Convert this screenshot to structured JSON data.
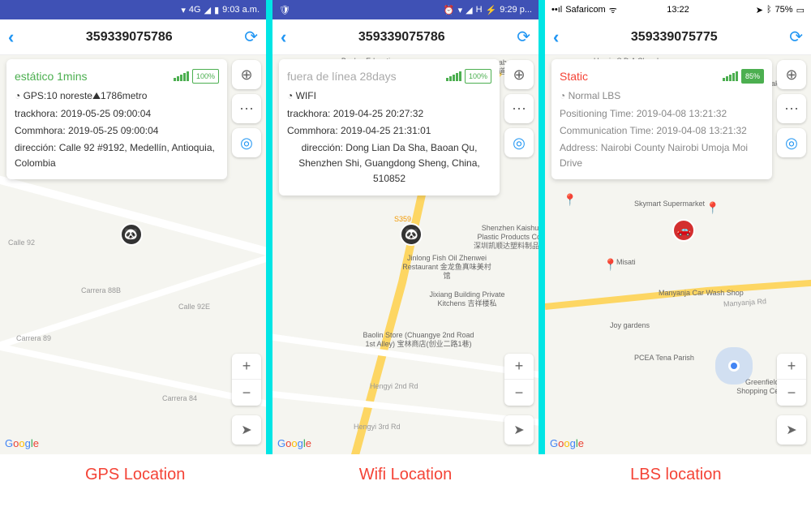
{
  "panels": [
    {
      "statusbar": {
        "type": "android",
        "network": "4G",
        "time": "9:03 a.m."
      },
      "header": {
        "title": "359339075786"
      },
      "info": {
        "status": "estático 1mins",
        "statusClass": "status-green",
        "battery": "100%",
        "line1": "GPS:10 noreste⛰1786metro",
        "line2": "trackhora: 2019-05-25 09:00:04",
        "line3": "Commhora: 2019-05-25 09:00:04",
        "addr": "dirección: Calle 92 #9192, Medellín, Antioquia, Colombia"
      },
      "marker": {
        "icon": "🐼",
        "class": ""
      },
      "label": "GPS Location"
    },
    {
      "statusbar": {
        "type": "android",
        "network": "H",
        "time": "9:29 p..."
      },
      "header": {
        "title": "359339075786"
      },
      "info": {
        "status": "fuera de línea 28days",
        "statusClass": "status-grey",
        "battery": "100%",
        "line1": "WIFI",
        "line2": "trackhora: 2019-04-25 20:27:32",
        "line3": "Commhora: 2019-04-25 21:31:01",
        "addr": "dirección: Dong Lian Da Sha, Baoan Qu, Shenzhen Shi, Guangdong Sheng, China, 510852"
      },
      "marker": {
        "icon": "🐼",
        "class": ""
      },
      "maplabels": [
        "Bao'an Education Industrial Zone 宝安教育工业区",
        "GAC Toyota Daxing Dabao Branch 广汽丰田大道",
        "Jinlong Fish Oil Zhenwei Restaurant 金龙鱼真味美村馆",
        "Jixiang Building Private Kitchens 吉祥楼私",
        "Baolin Store (Chuangye 2nd Road 1st Alley) 宝林商店(创业二路1巷)",
        "Shenzhen Kaishu Plastic Products Co. 深圳凯顺达塑料制品厂"
      ],
      "label": "Wifi Location"
    },
    {
      "statusbar": {
        "type": "ios",
        "carrier": "Safaricom",
        "time": "13:22",
        "battery": "75%"
      },
      "header": {
        "title": "359339075775"
      },
      "info": {
        "status": "Static",
        "statusClass": "status-red",
        "battery": "85%",
        "line1": "Normal  LBS",
        "line2": "Positioning Time: 2019-04-08 13:21:32",
        "line3": "Communication Time: 2019-04-08 13:21:32",
        "addr": "Address: Nairobi County Nairobi Umoja Moi Drive"
      },
      "marker": {
        "icon": "🚗",
        "class": "red"
      },
      "maplabels": [
        "Umoja S.D.A Church",
        "Grand Supermaket",
        "Skymart Supermarket",
        "Misati",
        "Manyanja Car Wash Shop",
        "Joy gardens",
        "PCEA Tena Parish",
        "Greenfields Shopping Centre"
      ],
      "label": "LBS location"
    }
  ]
}
